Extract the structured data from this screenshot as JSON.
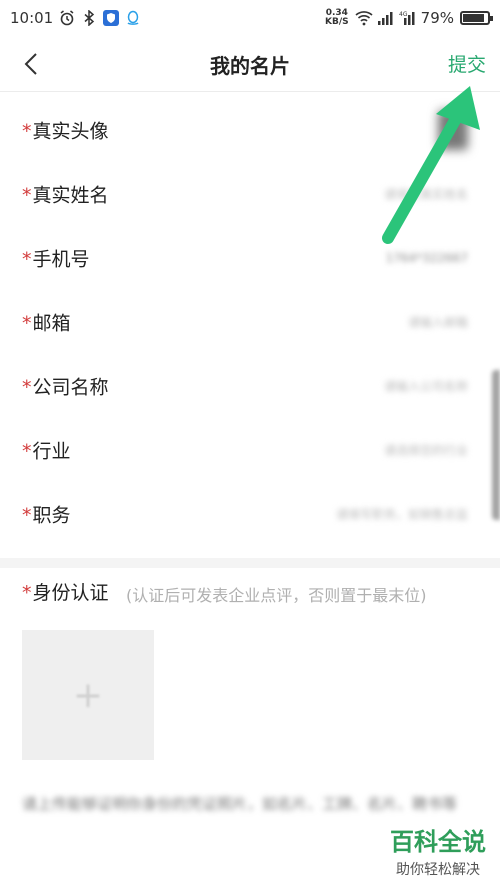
{
  "status_bar": {
    "time": "10:01",
    "net_speed_top": "0.34",
    "net_speed_unit": "KB/S",
    "battery_percent": "79%",
    "battery_level": 0.79
  },
  "header": {
    "title": "我的名片",
    "submit_label": "提交"
  },
  "form": {
    "required_marker": "*",
    "fields": [
      {
        "label": "真实头像",
        "value": ""
      },
      {
        "label": "真实姓名",
        "value": "请填写真实姓名"
      },
      {
        "label": "手机号",
        "value": "1764*322667"
      },
      {
        "label": "邮箱",
        "value": "请输入邮箱"
      },
      {
        "label": "公司名称",
        "value": "请输入公司名称"
      },
      {
        "label": "行业",
        "value": "请选择您的行业"
      },
      {
        "label": "职务",
        "value": "请填写职务，如销售总监"
      }
    ]
  },
  "identity": {
    "title": "身份认证",
    "hint": "(认证后可发表企业点评，否则置于最末位)",
    "upload_plus": "+",
    "description": "请上传能够证明你身份的凭证照片，如名片、工牌、名片、聘书等"
  },
  "watermark": {
    "logo": "百科全说",
    "sub": "助你轻松解决"
  },
  "colors": {
    "accent": "#28a870",
    "required": "#d23b3b",
    "arrow": "#2bc47a"
  }
}
